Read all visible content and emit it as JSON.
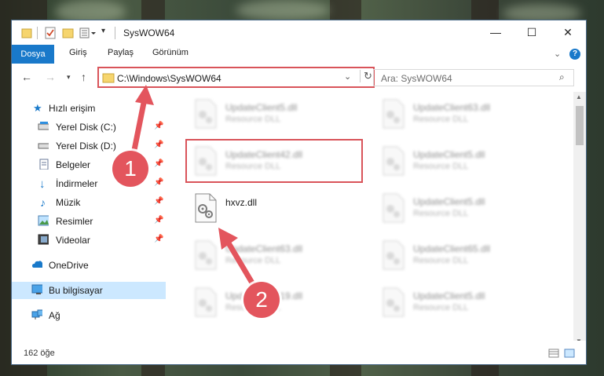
{
  "window": {
    "title": "SysWOW64",
    "controls": {
      "minimize": "—",
      "maximize": "☐",
      "close": "✕"
    }
  },
  "ribbon": {
    "tabs": [
      "Dosya",
      "Giriş",
      "Paylaş",
      "Görünüm"
    ],
    "help_icon": "?"
  },
  "navigation": {
    "address": "C:\\Windows\\SysWOW64",
    "search_placeholder": "Ara: SysWOW64"
  },
  "sidebar": {
    "quick_access": "Hızlı erişim",
    "items": [
      {
        "label": "Yerel Disk (C:)",
        "icon": "drive-icon",
        "pinned": true
      },
      {
        "label": "Yerel Disk (D:)",
        "icon": "drive-icon",
        "pinned": true
      },
      {
        "label": "Belgeler",
        "icon": "documents-icon",
        "pinned": true
      },
      {
        "label": "İndirmeler",
        "icon": "download-icon",
        "pinned": true
      },
      {
        "label": "Müzik",
        "icon": "music-icon",
        "pinned": true
      },
      {
        "label": "Resimler",
        "icon": "pictures-icon",
        "pinned": true
      },
      {
        "label": "Videolar",
        "icon": "videos-icon",
        "pinned": true
      }
    ],
    "onedrive": "OneDrive",
    "this_pc": "Bu bilgisayar",
    "network": "Ağ"
  },
  "files": {
    "left_column": [
      {
        "name": "UpdateClient5.dll",
        "type": "Resource DLL"
      },
      {
        "name": "UpdateClient42.dll",
        "type": "Resource DLL"
      },
      {
        "name": "hxvz.dll",
        "type": ""
      },
      {
        "name": "UpdateClient63.dll",
        "type": "Resource DLL"
      },
      {
        "name": "UpdateClient19.dll",
        "type": "Resource DLL"
      }
    ],
    "right_column": [
      {
        "name": "UpdateClient63.dll",
        "type": "Resource DLL"
      },
      {
        "name": "UpdateClient5.dll",
        "type": "Resource DLL"
      },
      {
        "name": "UpdateClient5.dll",
        "type": "Resource DLL"
      },
      {
        "name": "UpdateClient65.dll",
        "type": "Resource DLL"
      },
      {
        "name": "UpdateClient5.dll",
        "type": "Resource DLL"
      }
    ]
  },
  "status": {
    "item_count": "162 öğe"
  },
  "annotations": {
    "step1": "1",
    "step2": "2"
  },
  "colors": {
    "accent": "#1979ca",
    "highlight": "#d9545a",
    "selected": "#cce8ff"
  }
}
